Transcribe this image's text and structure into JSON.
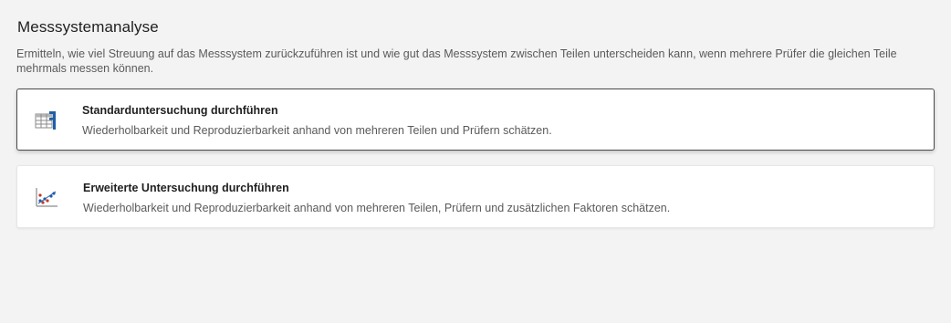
{
  "header": {
    "title": "Messsystemanalyse",
    "description": "Ermitteln, wie viel Streuung auf das Messsystem zurückzuführen ist und wie gut das Messsystem zwischen Teilen unterscheiden kann, wenn mehrere Prüfer die gleichen Teile mehrmals messen können."
  },
  "options": [
    {
      "title": "Standarduntersuchung durchführen",
      "description": "Wiederholbarkeit und Reproduzierbarkeit anhand von mehreren Teilen und Prüfern schätzen.",
      "icon": "table-chart-icon",
      "selected": true
    },
    {
      "title": "Erweiterte Untersuchung durchführen",
      "description": "Wiederholbarkeit und Reproduzierbarkeit anhand von mehreren Teilen, Prüfern und zusätzlichen Faktoren schätzen.",
      "icon": "scatter-plot-icon",
      "selected": false
    }
  ],
  "colors": {
    "background": "#f3f3f4",
    "accent": "#1f5fa8",
    "selected_border": "#4a4a4a"
  }
}
